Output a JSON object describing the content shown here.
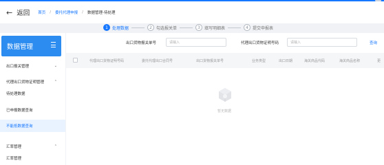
{
  "colors": {
    "accent": "#1677ff",
    "sidebar_header": "#2d8cf0",
    "selected_bg": "#e9f3ff"
  },
  "header": {
    "back_label": "返回",
    "breadcrumbs": [
      "首页",
      "委托代理申报",
      "数据管理-待处理"
    ]
  },
  "stepper": {
    "steps": [
      {
        "number": "1",
        "label": "处理数据",
        "active": true
      },
      {
        "number": "2",
        "label": "勾选报关单",
        "active": false
      },
      {
        "number": "3",
        "label": "填写明细表",
        "active": false
      },
      {
        "number": "4",
        "label": "提交申报表",
        "active": false
      }
    ]
  },
  "sidebar": {
    "title": "数据管理",
    "items": [
      {
        "label": "出口报关管理",
        "chevron": "⌄"
      },
      {
        "label": "代理出口货物证明管理",
        "chevron": "⌃"
      },
      {
        "label": "待处理数据",
        "chevron": ""
      },
      {
        "label": "已申报数据查询",
        "chevron": ""
      },
      {
        "label": "不能抵数据查询",
        "chevron": ""
      },
      {
        "label": "汇率管理",
        "chevron": "⌃"
      },
      {
        "label": "汇率管理",
        "chevron": ""
      }
    ]
  },
  "filters": {
    "customs_label": "出口货物报关单号",
    "customs_placeholder": "请输入",
    "cert_label": "代理出口货物证明号码",
    "cert_placeholder": "请输入",
    "query_label": "查询"
  },
  "table": {
    "columns": [
      "代理出口货物证明号码",
      "委托代理出口合同号",
      "出口货物报关单号",
      "业务类型",
      "出口日期",
      "海关商品代码",
      "海关商品名称",
      "更"
    ]
  },
  "empty": {
    "text": "暂无数据"
  }
}
